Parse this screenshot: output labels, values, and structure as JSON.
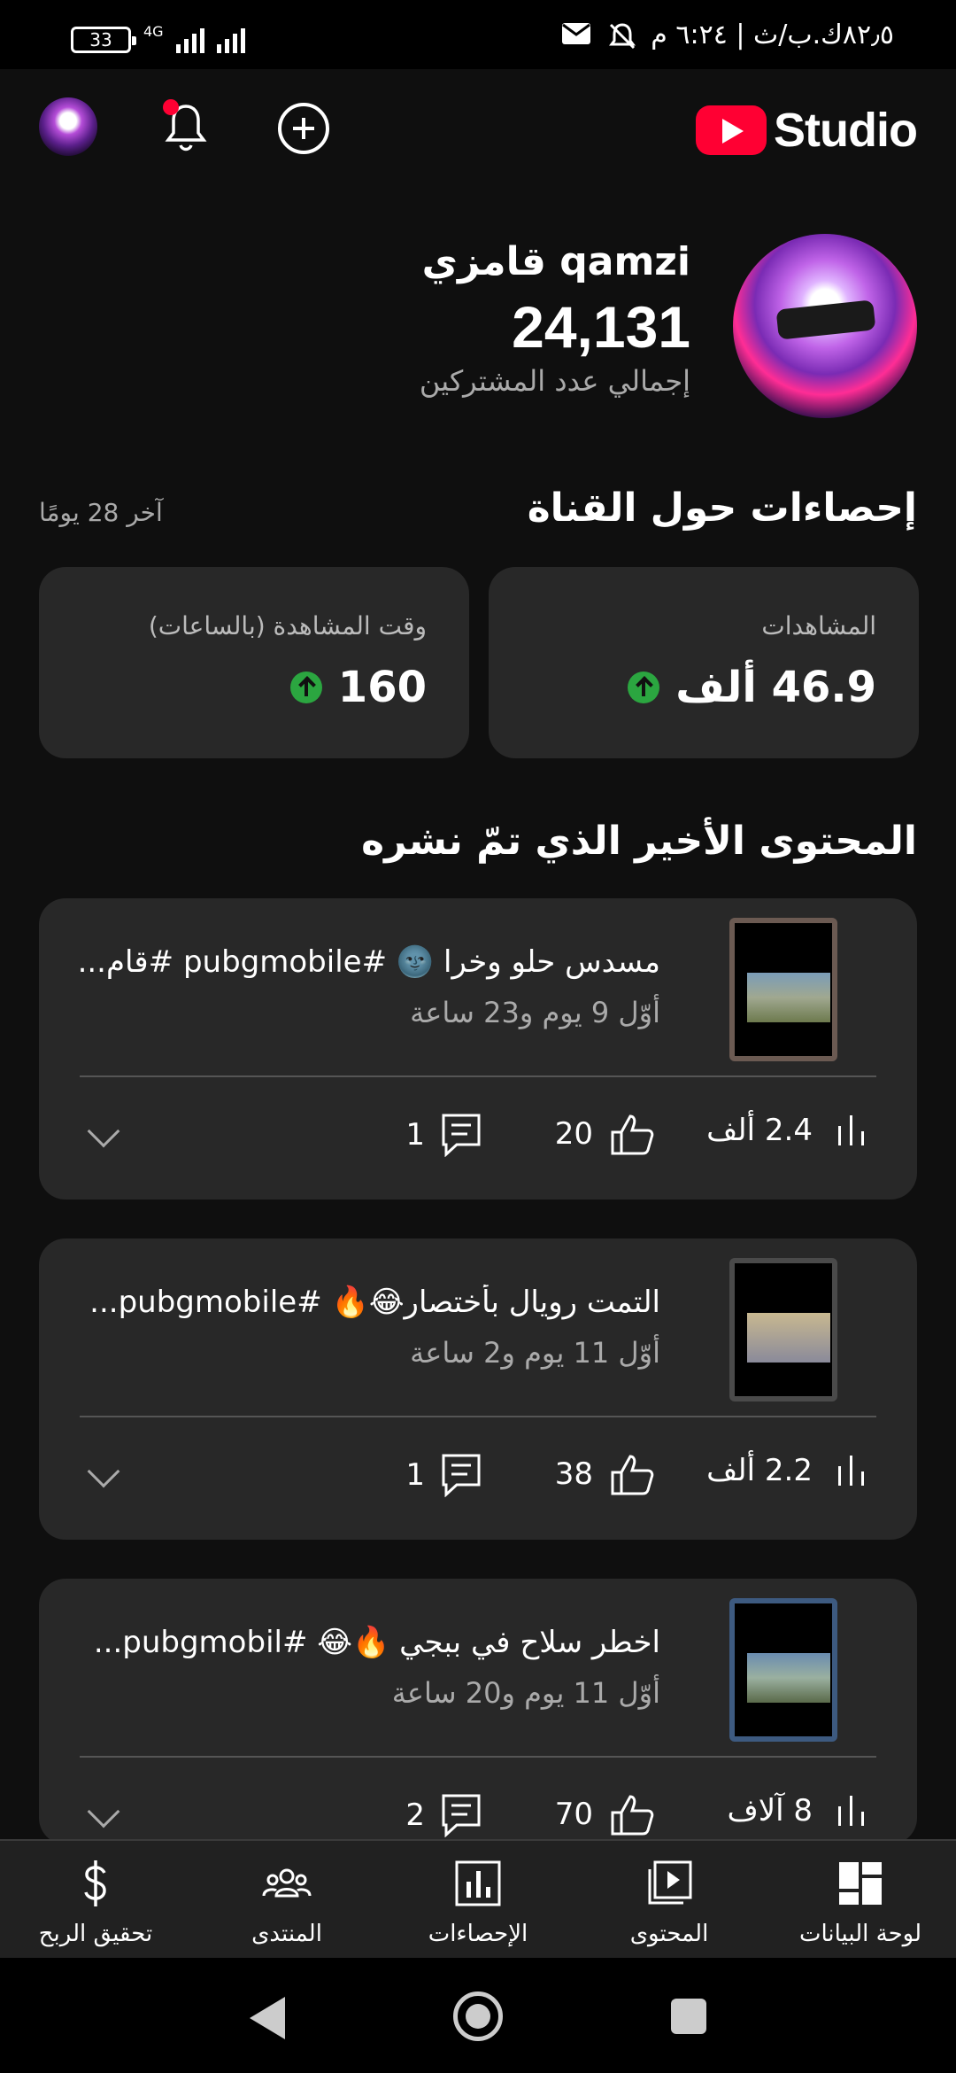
{
  "status_bar": {
    "time_text": "٦:٢٤ م",
    "indicators": "٨٢٫٥ك.ب/ث",
    "battery": "33",
    "network": "4G"
  },
  "header": {
    "brand": "Studio",
    "icons": [
      "avatar",
      "notification-bell-icon",
      "create-plus-icon",
      "youtube-logo"
    ]
  },
  "channel": {
    "name": "qamzi قامزي",
    "subscribers": "24,131",
    "subscribers_label": "إجمالي عدد المشتركين"
  },
  "analytics": {
    "title": "إحصاءات حول القناة",
    "period": "آخر 28 يومًا",
    "cards": [
      {
        "label": "المشاهدات",
        "value": "46.9 ألف",
        "trend": "up"
      },
      {
        "label": "وقت المشاهدة (بالساعات)",
        "value": "160",
        "trend": "up"
      }
    ]
  },
  "recent": {
    "title": "المحتوى الأخير الذي تمّ نشره",
    "videos": [
      {
        "title": "مسدس حلو وخرا 🌚 #pubgmobile #قام...",
        "age": "أوّل 9 يوم و23 ساعة",
        "views": "2.4 ألف",
        "likes": "20",
        "comments": "1"
      },
      {
        "title": "التمت رويال بأختصار😂🔥 #pubgmobile...",
        "age": "أوّل 11 يوم و2 ساعة",
        "views": "2.2 ألف",
        "likes": "38",
        "comments": "1"
      },
      {
        "title": "اخطر سلاح في ببجي 🔥😂 #pubgmobil...",
        "age": "أوّل 11 يوم و20 ساعة",
        "views": "8 آلاف",
        "likes": "70",
        "comments": "2"
      }
    ]
  },
  "bottom_nav": [
    {
      "label": "لوحة البيانات",
      "icon": "dashboard-icon"
    },
    {
      "label": "المحتوى",
      "icon": "content-icon"
    },
    {
      "label": "الإحصاءات",
      "icon": "analytics-icon"
    },
    {
      "label": "المنتدى",
      "icon": "community-icon"
    },
    {
      "label": "تحقيق الربح",
      "icon": "monetization-icon"
    }
  ],
  "colors": {
    "background": "#0f0f0f",
    "card": "#282828",
    "accent_red": "#ff0033",
    "trend_green": "#2ba640"
  }
}
